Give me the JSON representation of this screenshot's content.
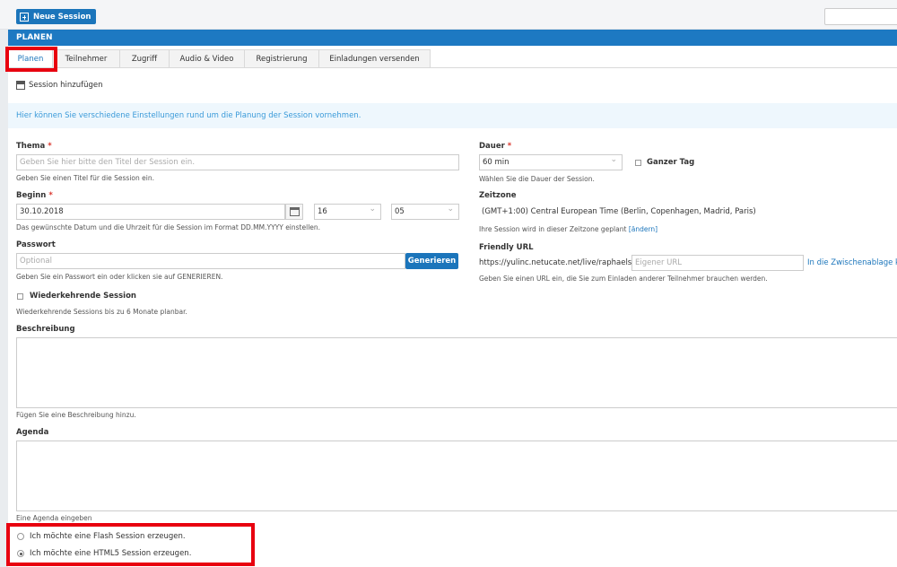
{
  "toolbar": {
    "new_session_label": "Neue Session"
  },
  "panel": {
    "title": "PLANEN"
  },
  "tabs": [
    {
      "label": "Planen",
      "active": true
    },
    {
      "label": "Teilnehmer"
    },
    {
      "label": "Zugriff"
    },
    {
      "label": "Audio & Video"
    },
    {
      "label": "Registrierung"
    },
    {
      "label": "Einladungen versenden"
    }
  ],
  "section": {
    "add_session_label": "Session hinzufügen"
  },
  "info": {
    "text": "Hier können Sie verschiedene Einstellungen rund um die Planung der Session vornehmen."
  },
  "form": {
    "required_mark": "*",
    "thema": {
      "label": "Thema",
      "placeholder": "Geben Sie hier bitte den Titel der Session ein.",
      "help": "Geben Sie einen Titel für die Session ein."
    },
    "beginn": {
      "label": "Beginn",
      "date": "30.10.2018",
      "hour": "16",
      "minute": "05",
      "help": "Das gewünschte Datum und die Uhrzeit für die Session im Format DD.MM.YYYY einstellen."
    },
    "passwort": {
      "label": "Passwort",
      "placeholder": "Optional",
      "button": "Generieren",
      "help": "Geben Sie ein Passwort ein oder klicken sie auf GENERIEREN."
    },
    "recurring": {
      "label": "Wiederkehrende Session",
      "help": "Wiederkehrende Sessions bis zu 6 Monate planbar."
    },
    "beschreibung": {
      "label": "Beschreibung",
      "help": "Fügen Sie eine Beschreibung hinzu."
    },
    "agenda": {
      "label": "Agenda",
      "help": "Eine Agenda eingeben"
    },
    "dauer": {
      "label": "Dauer",
      "value": "60 min",
      "ganzer_tag": "Ganzer Tag",
      "help": "Wählen Sie die Dauer der Session."
    },
    "zeitzone": {
      "label": "Zeitzone",
      "value": "(GMT+1:00) Central European Time (Berlin, Copenhagen, Madrid, Paris)",
      "help": "Ihre Session wird in dieser Zeitzone geplant",
      "change_link": "[ändern]"
    },
    "friendly_url": {
      "label": "Friendly URL",
      "prefix": "https://yulinc.netucate.net/live/raphaels/",
      "placeholder": "Eigener URL",
      "copy_link": "In die Zwischenablage ko",
      "help": "Geben Sie einen URL ein, die Sie zum Einladen anderer Teilnehmer brauchen werden."
    },
    "session_type": {
      "flash": "Ich möchte eine Flash Session erzeugen.",
      "html5": "Ich möchte eine HTML5 Session erzeugen.",
      "selected": "html5"
    }
  }
}
